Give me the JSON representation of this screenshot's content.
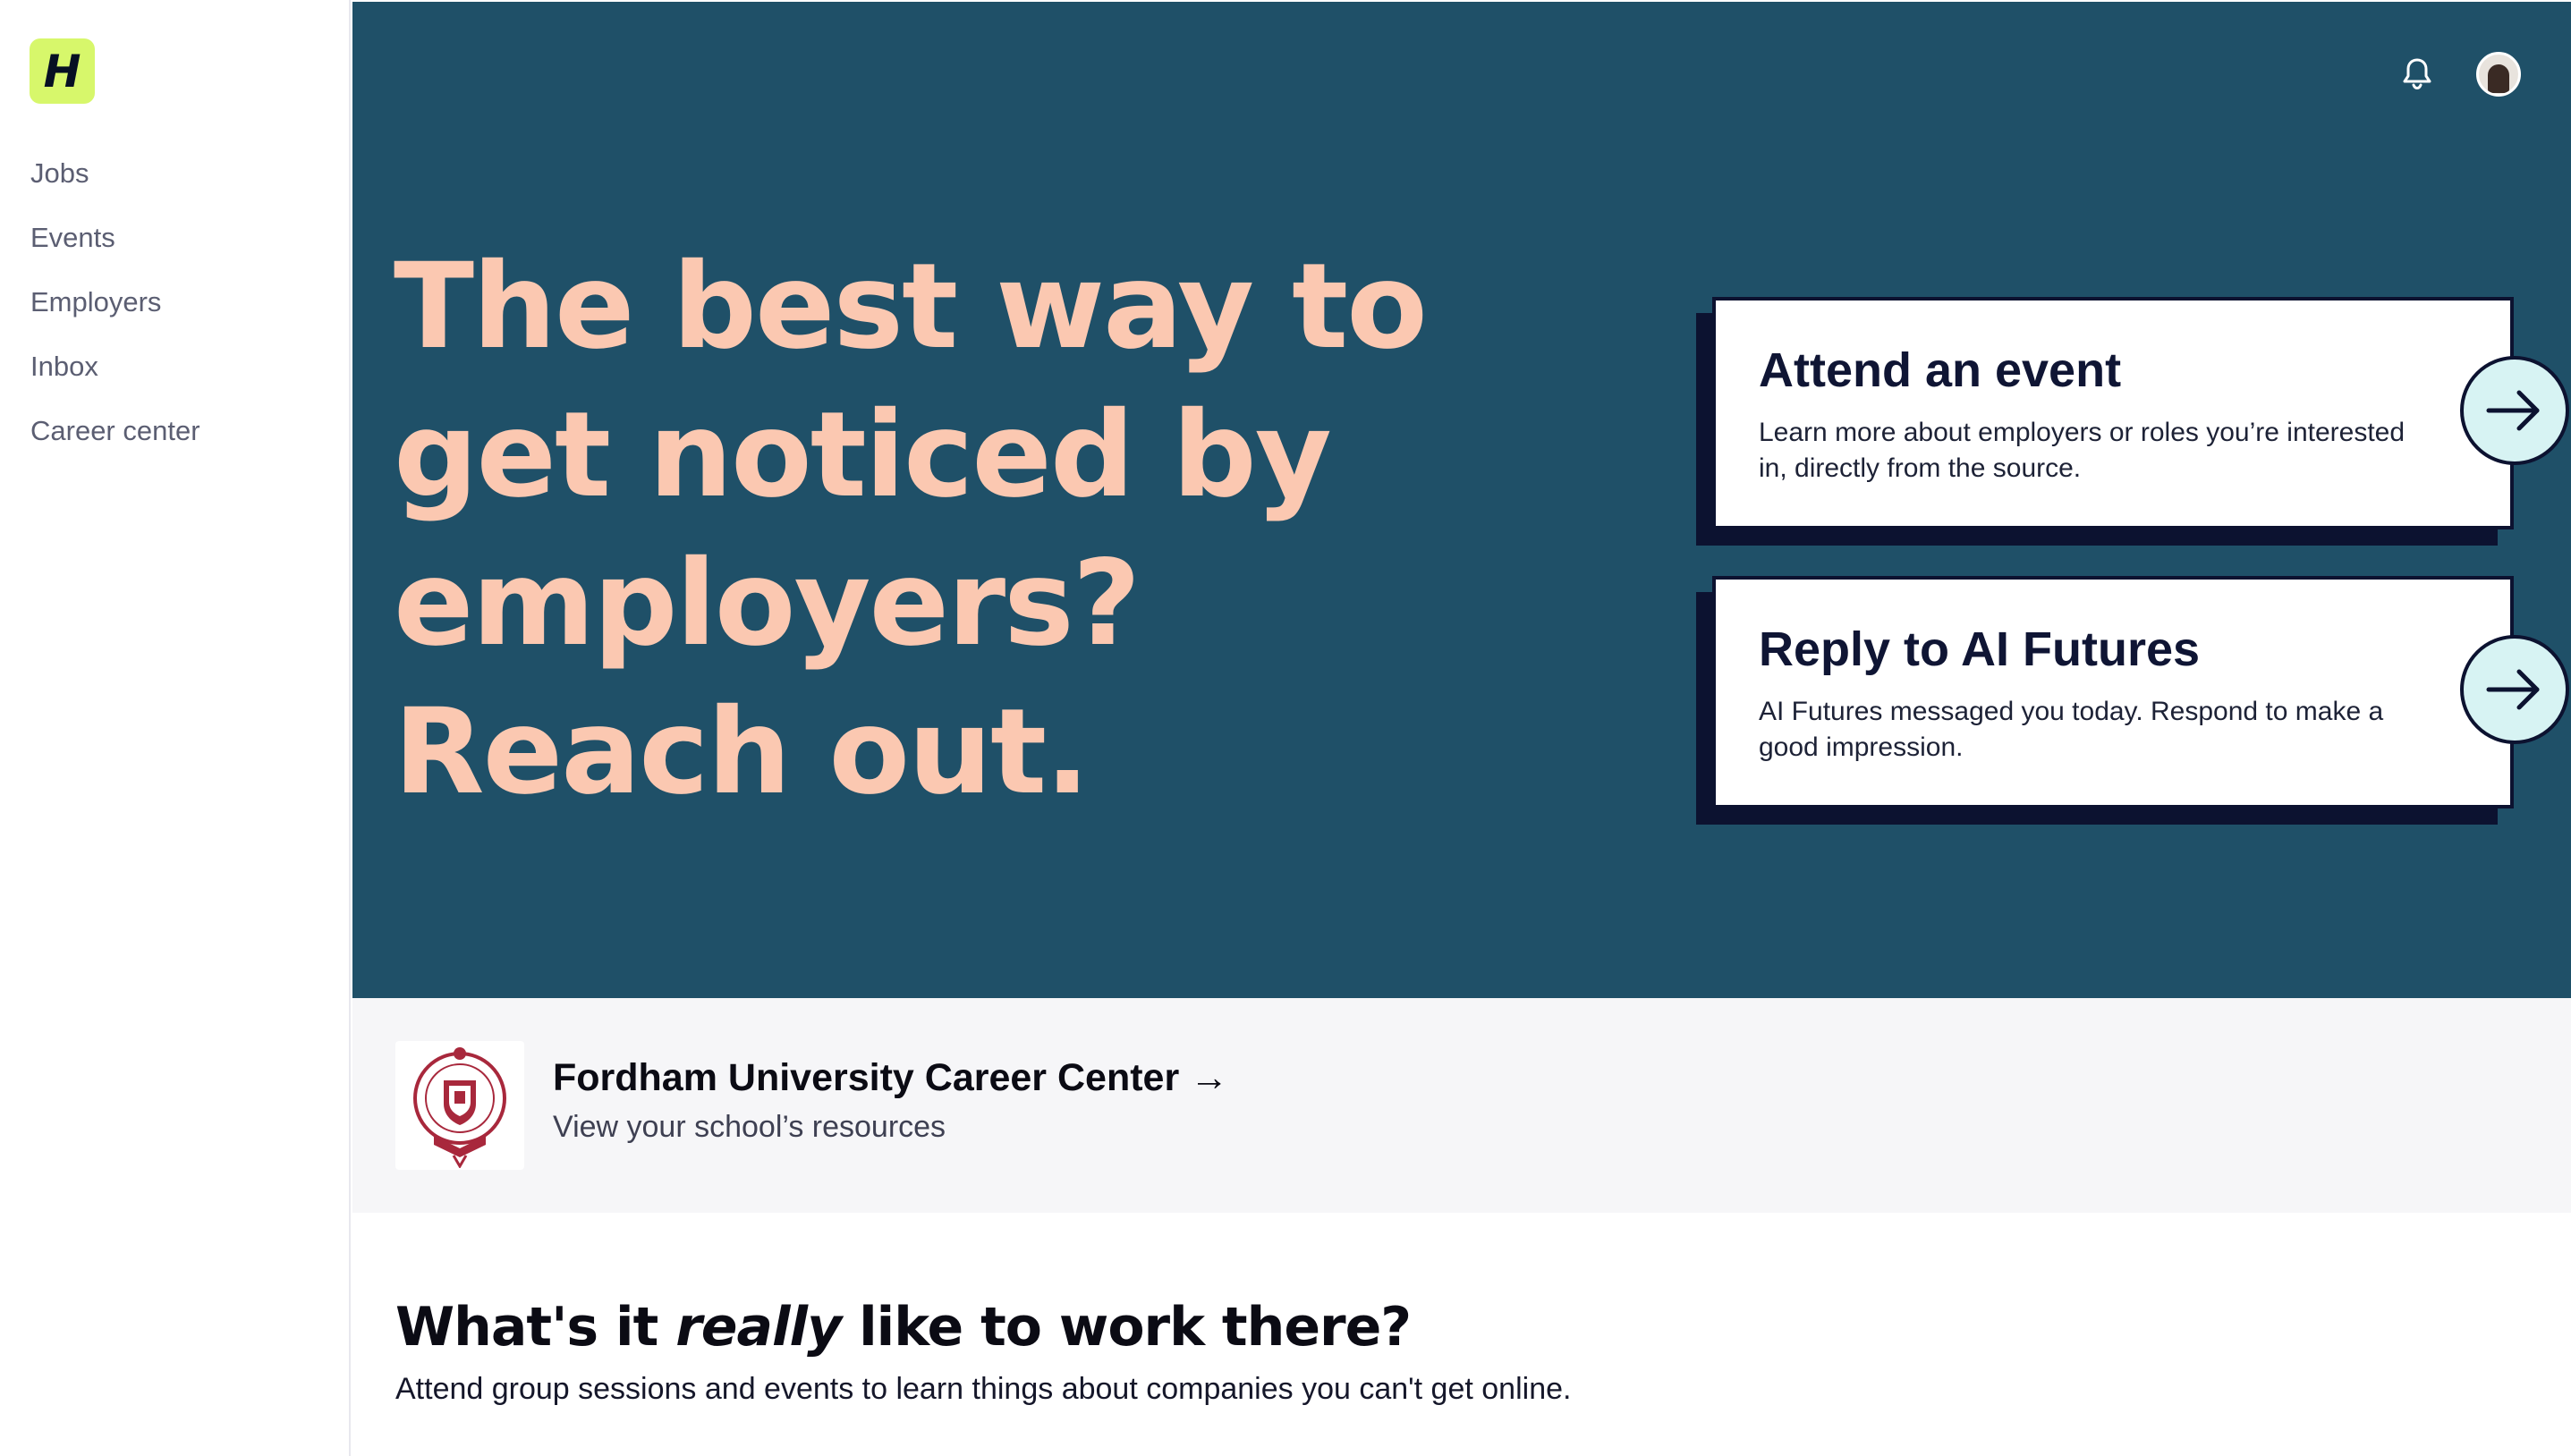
{
  "sidebar": {
    "logo_letter": "H",
    "items": [
      {
        "label": "Jobs"
      },
      {
        "label": "Events"
      },
      {
        "label": "Employers"
      },
      {
        "label": "Inbox"
      },
      {
        "label": "Career center"
      }
    ]
  },
  "header": {
    "notification_icon": "bell-icon",
    "avatar_icon": "user-avatar"
  },
  "hero": {
    "headline_lines": [
      "The best way to",
      "get noticed by",
      "employers?",
      "Reach out."
    ],
    "cards": [
      {
        "title": "Attend an event",
        "description": "Learn more about employers or roles you’re interested in, directly from the source."
      },
      {
        "title": "Reply to AI Futures",
        "description": "AI Futures messaged you today. Respond to make a good impression."
      }
    ]
  },
  "school": {
    "title": "Fordham University Career Center →",
    "subtitle": "View your school’s resources"
  },
  "section": {
    "title_before": "What's it ",
    "title_em": "really",
    "title_after": " like to work there?",
    "subtitle": "Attend group sessions and events to learn things about companies you can't get online."
  },
  "colors": {
    "hero_bg": "#1f5068",
    "headline": "#fbc8b1",
    "logo_bg": "#d7f76b",
    "arrow_bg": "#d7f3f3",
    "card_border": "#0c1230",
    "school_band": "#f6f6f8"
  }
}
